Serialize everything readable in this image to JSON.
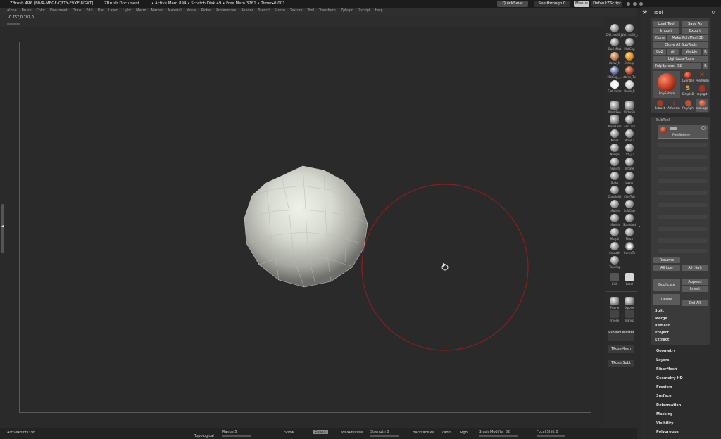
{
  "titlebar": {
    "app_title": "ZBrush 4R6 [BIVR-MBGF-QFTY-EVXE-NGXT]",
    "document": "ZBrush Document",
    "stats": "• Active Mem 894 • Scratch Disk 49 • Free Mem 3281 • Timer▸0.001",
    "quicksave": "QuickSave",
    "see_through": "See-through 0",
    "menus": "Menus",
    "script": "DefaultZScript"
  },
  "menubar": {
    "items": [
      "Alpha",
      "Brush",
      "Color",
      "Document",
      "Draw",
      "Edit",
      "File",
      "Layer",
      "Light",
      "Macro",
      "Marker",
      "Material",
      "Movie",
      "Picker",
      "Preferences",
      "Render",
      "Stencil",
      "Stroke",
      "Texture",
      "Tool",
      "Transform",
      "Zplugin",
      "Zscript",
      "Help"
    ]
  },
  "coords": "-0.767,0.707,0",
  "shelf": {
    "materials": [
      {
        "label": "DW...ssRB_pub"
      },
      {
        "label": "DW...ssRB_pub"
      },
      {
        "label": "BasicMat"
      },
      {
        "label": "MatCap"
      },
      {
        "label": "dbrsv_M"
      },
      {
        "label": "Orange"
      },
      {
        "label": "MatCap_..."
      },
      {
        "label": "dbrsv_Tv"
      },
      {
        "label": "Flat Color"
      },
      {
        "label": "Basic_B"
      }
    ],
    "brushes": [
      {
        "label": "MaskPen"
      },
      {
        "label": "SliderBu"
      },
      {
        "label": "MaskLass"
      },
      {
        "label": "ZBrCurv"
      },
      {
        "label": "Move"
      },
      {
        "label": "Move T"
      },
      {
        "label": "Nudge"
      },
      {
        "label": "Orb_Cr"
      },
      {
        "label": "hPolish"
      },
      {
        "label": "Inflate"
      },
      {
        "label": "Spiky"
      },
      {
        "label": "Layer"
      },
      {
        "label": "ClayBuild"
      },
      {
        "label": "ClayTub"
      },
      {
        "label": "hPolish"
      },
      {
        "label": "SoftClay"
      },
      {
        "label": "hPolish"
      },
      {
        "label": "Standard"
      },
      {
        "label": "Morph"
      },
      {
        "label": "Pinch"
      },
      {
        "label": "Smooth"
      },
      {
        "label": "CurveTu"
      },
      {
        "label": "Topolog"
      }
    ],
    "extra": [
      {
        "label": "Edit"
      },
      {
        "label": "Local"
      },
      {
        "label": "Frame"
      },
      {
        "label": "Xpose"
      },
      {
        "label": "Vpose"
      },
      {
        "label": "Transp"
      }
    ],
    "subtool_master": "SubTool Master",
    "tposemesh": "TPoseMesh",
    "tposesubt": "TPose Subt"
  },
  "tool": {
    "header": "Tool",
    "load_tool": "Load Tool",
    "save_as": "Save As",
    "import": "Import",
    "export": "Export",
    "clone": "Clone",
    "make_polymesh": "Make PolyMesh3D",
    "clone_all": "Clone All SubTools",
    "goz": "GoZ",
    "all": "All",
    "visible": "Visible",
    "r": "R",
    "lightbox": "Lightbox▸Tools",
    "polysphere": "PolySphere_ 92",
    "tool_thumbs": [
      {
        "label": "PolySphere"
      },
      {
        "label": "Cylinder"
      },
      {
        "label": "PolyMesh"
      },
      {
        "label": "SimpleB"
      },
      {
        "label": "rogegrt"
      },
      {
        "label": "Extract"
      },
      {
        "label": "Alfasrcm"
      },
      {
        "label": "PolySph"
      },
      {
        "label": "manage"
      }
    ],
    "subtool_title": "SubTool",
    "subtool_item": "PolySphere",
    "rename": "Rename",
    "all_low": "All Low",
    "all_high": "All High",
    "duplicate": "Duplicate",
    "append": "Append",
    "insert": "Insert",
    "delete": "Delete",
    "del_all": "Del All",
    "split": "Split",
    "merge": "Merge",
    "remesh": "Remesh",
    "project": "Project",
    "extract": "Extract"
  },
  "panels": [
    "Geometry",
    "Layers",
    "FiberMesh",
    "Geometry HD",
    "Preview",
    "Surface",
    "Deformation",
    "Masking",
    "Visibility",
    "Polygroups"
  ],
  "status": {
    "active_points": "ActivePoints: 98",
    "range": "Range 5",
    "show": "Show",
    "colors": "Colors",
    "wax_preview": "WaxPreview",
    "strength": "Strength 0",
    "backface": "BackFaceMa",
    "zadd": "Zadd",
    "rgb": "Rgb",
    "brush_modifier": "Brush Modifier 52",
    "focal_shift": "Focal Shift 0",
    "topological": "Topological"
  },
  "colors": {
    "accent_orange": "#d3861c",
    "brush_circle": "#8b1e1e",
    "background": "#2a2a2a"
  }
}
